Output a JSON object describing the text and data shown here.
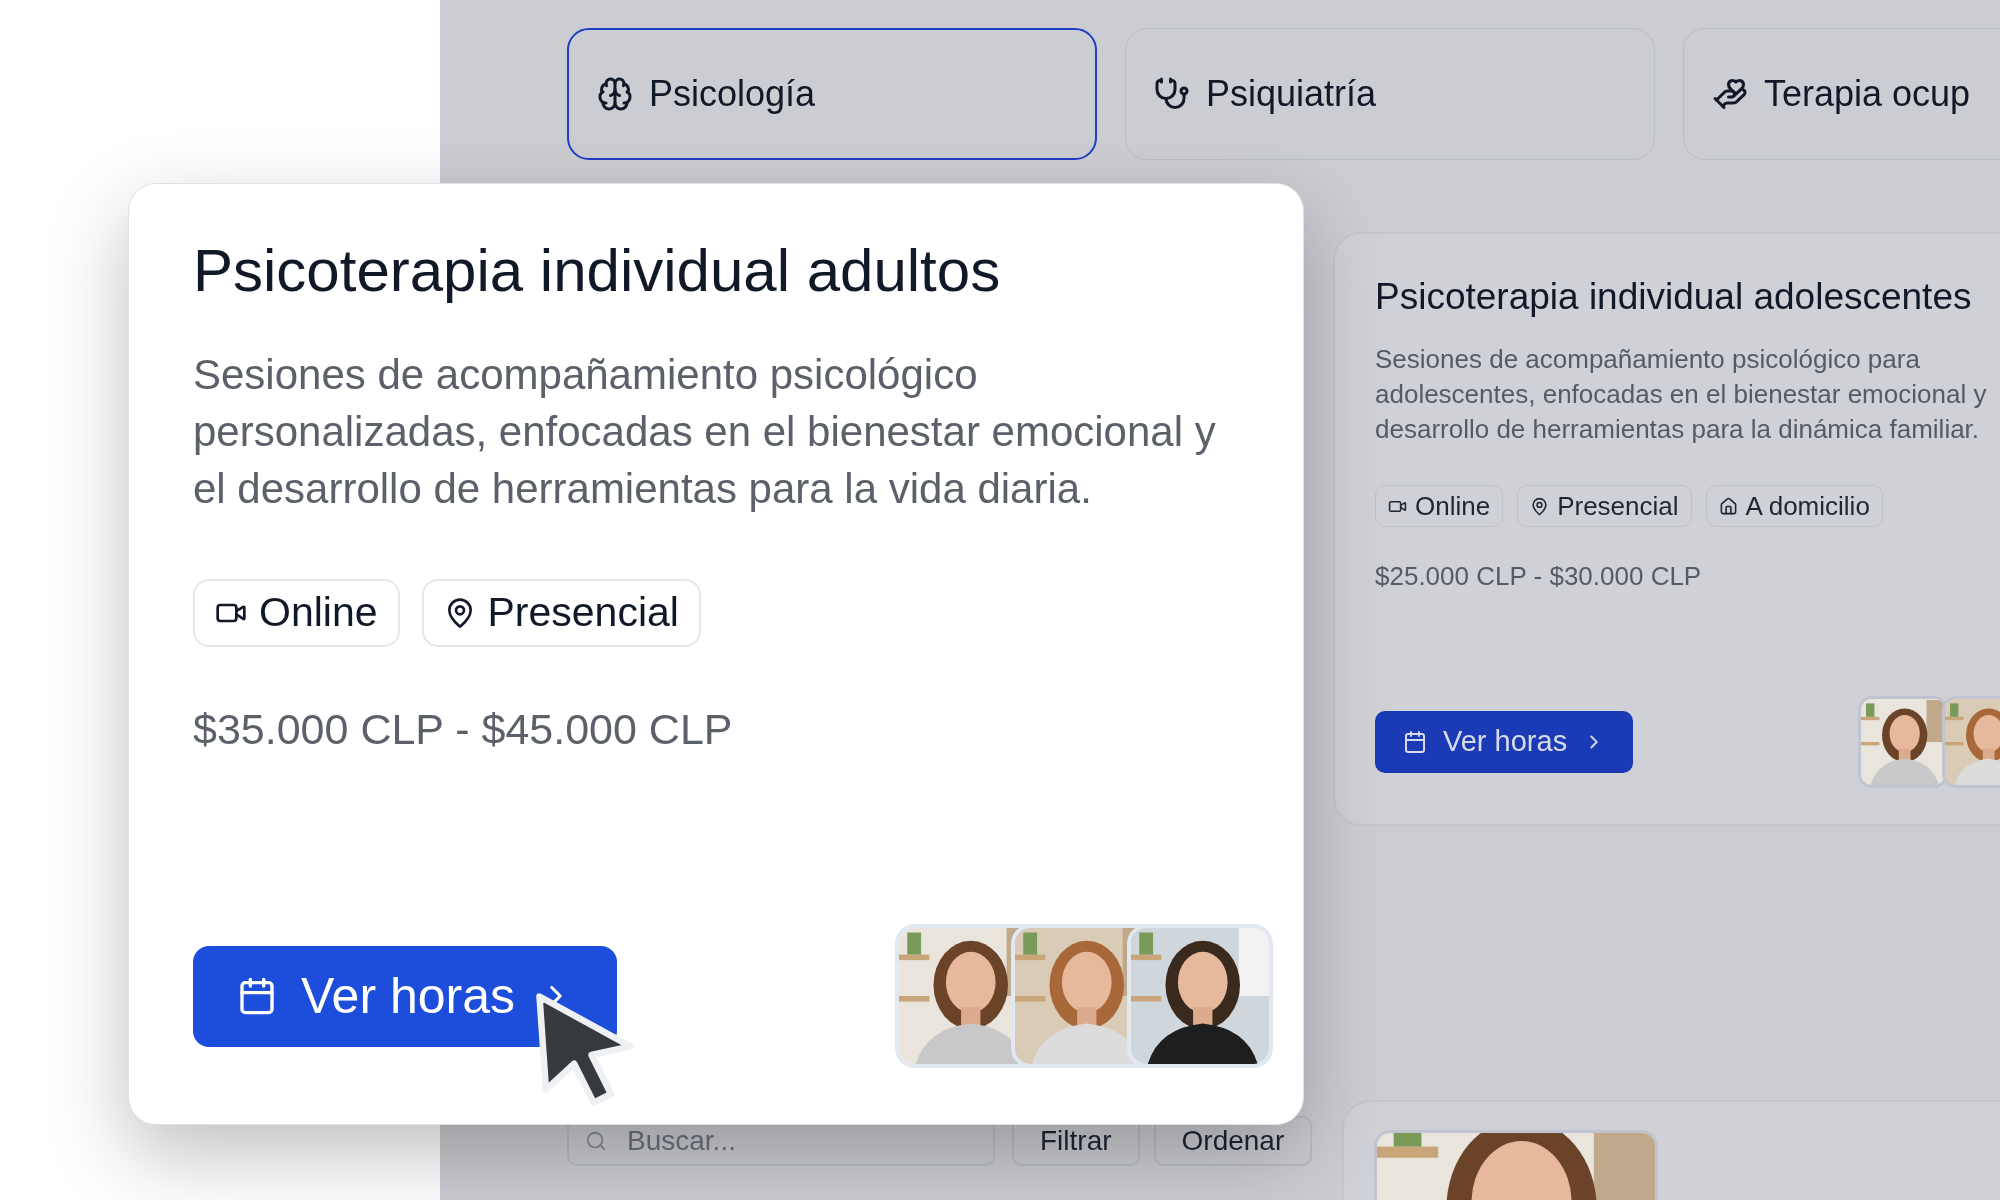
{
  "tabs": [
    {
      "label": "Psicología",
      "kind": "brain",
      "selected": true
    },
    {
      "label": "Psiquiatría",
      "kind": "stethoscope",
      "selected": false
    },
    {
      "label": "Terapia ocup",
      "kind": "hands",
      "selected": false
    }
  ],
  "featured_card": {
    "title": "Psicoterapia individual adultos",
    "description_lines": [
      "Sesiones de acompañamiento psicológico",
      "personalizadas, enfocadas en el bienestar emocional y",
      "el desarrollo de herramientas para la vida diaria."
    ],
    "tags": [
      {
        "kind": "online",
        "label": "Online"
      },
      {
        "kind": "presencial",
        "label": "Presencial"
      }
    ],
    "price": "$35.000 CLP - $45.000 CLP",
    "button": "Ver horas",
    "photos": [
      {
        "kind": "picture"
      },
      {
        "kind": "picture"
      },
      {
        "kind": "picture"
      }
    ]
  },
  "cards": [
    {
      "title": "Psicoterapia individual adolescentes",
      "description_lines": [
        "Sesiones de acompañamiento psicológico para",
        "adolescentes, enfocadas en el bienestar emocional y",
        "desarrollo de herramientas para la dinámica familiar."
      ],
      "tags": [
        {
          "kind": "online",
          "label": "Online"
        },
        {
          "kind": "presencial",
          "label": "Presencial"
        },
        {
          "kind": "domicilio",
          "label": "A domicilio"
        }
      ],
      "price": "$25.000 CLP - $30.000 CLP",
      "button": "Ver horas",
      "photos": [
        {
          "kind": "picture"
        },
        {
          "kind": "picture"
        }
      ]
    }
  ],
  "search": {
    "placeholder": "Buscar..."
  },
  "toolbar_buttons": [
    "Filtrar",
    "Ordenar"
  ],
  "bottom_card": {
    "photos": [
      {
        "kind": "picture"
      }
    ]
  }
}
